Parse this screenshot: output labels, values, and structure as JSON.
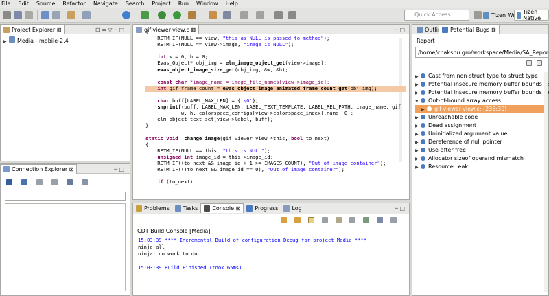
{
  "menu": [
    "File",
    "Edit",
    "Source",
    "Refactor",
    "Navigate",
    "Search",
    "Project",
    "Run",
    "Window",
    "Help"
  ],
  "toolbar": {
    "quick_access_placeholder": "Quick Access",
    "persp_web": "Tizen Web",
    "persp_native": "Tizen Native"
  },
  "left": {
    "project_tab": "Project Explorer",
    "project_item": "Media - mobile-2.4",
    "connection_tab": "Connection Explorer"
  },
  "editor": {
    "tab": "gif-viewer-view.c",
    "lines": [
      {
        "t": "{",
        "c": ""
      },
      {
        "t": "    RETM_IF(NULL == view, \"this as NULL is passed to method\");",
        "c": ""
      },
      {
        "t": "    RETM_IF(NULL == view->image, \"image is NULL\");",
        "c": ""
      },
      {
        "t": "",
        "c": ""
      },
      {
        "t": "    int w = 0, h = 0;",
        "c": ""
      },
      {
        "t": "    Evas_Object* obj_img = elm_image_object_get(view->image);",
        "c": ""
      },
      {
        "t": "    evas_object_image_size_get(obj_img, &w, &h);",
        "c": ""
      },
      {
        "t": "",
        "c": ""
      },
      {
        "t": "    const char *image_name = image_file_names[view->image_id];",
        "c": "hl"
      },
      {
        "t": "    int gif_frame_count = evas_object_image_animated_frame_count_get(obj_img);",
        "c": ""
      },
      {
        "t": "",
        "c": ""
      },
      {
        "t": "    char buff[LABEL_MAX_LEN] = {'\\0'};",
        "c": ""
      },
      {
        "t": "    snprintf(buff, LABEL_MAX_LEN, LABEL_TEXT_TEMPLATE, LABEL_REL_PATH, image_name, gif",
        "c": ""
      },
      {
        "t": "            w, h, colorspace_configs[view->colorspace_index].name, 0);",
        "c": ""
      },
      {
        "t": "    elm_object_text_set(view->label, buff);",
        "c": ""
      },
      {
        "t": "}",
        "c": ""
      },
      {
        "t": "",
        "c": ""
      },
      {
        "t": "static void _change_image(gif_viewer_view *this, bool to_next)",
        "c": ""
      },
      {
        "t": "{",
        "c": ""
      },
      {
        "t": "    RETM_IF(NULL == this, \"this is NULL\");",
        "c": ""
      },
      {
        "t": "    unsigned int image_id = this->image_id;",
        "c": ""
      },
      {
        "t": "    RETM_IF((to_next && image_id + 1 >= IMAGES_COUNT), \"Out of image container\");",
        "c": ""
      },
      {
        "t": "    RETM_IF((!to_next && image_id == 0), \"Out of image container\");",
        "c": ""
      },
      {
        "t": "",
        "c": ""
      },
      {
        "t": "    if (to_next)",
        "c": ""
      }
    ]
  },
  "console": {
    "tabs": [
      "Problems",
      "Tasks",
      "Console",
      "Progress",
      "Log"
    ],
    "title": "CDT Build Console [Media]",
    "lines": [
      {
        "t": "15:03:39 **** Incremental Build of configuration Debug for project Media ****",
        "c": "blue"
      },
      {
        "t": "ninja all",
        "c": ""
      },
      {
        "t": "ninja: no work to do.",
        "c": ""
      },
      {
        "t": "",
        "c": ""
      },
      {
        "t": "15:03:39 Build Finished (took 65ms)",
        "c": "blue"
      }
    ]
  },
  "right": {
    "tabs": [
      "Outline",
      "Potential Bugs"
    ],
    "report_label": "Report",
    "path": "/home/chakshu.gro/workspace/Media/SA_Repor",
    "items": [
      {
        "label": "Cast from non-struct type to struct type",
        "open": false,
        "sel": false,
        "indent": 0
      },
      {
        "label": "Potential insecure memory buffer bounds restrict",
        "open": false,
        "sel": false,
        "indent": 0
      },
      {
        "label": "Potential insecure memory buffer bounds restrict",
        "open": false,
        "sel": false,
        "indent": 0
      },
      {
        "label": "Out-of-bound array access",
        "open": true,
        "sel": false,
        "indent": 0
      },
      {
        "label": "gif-viewer-view.c: (235:30)",
        "open": false,
        "sel": true,
        "indent": 1
      },
      {
        "label": "Unreachable code",
        "open": false,
        "sel": false,
        "indent": 0
      },
      {
        "label": "Dead assignment",
        "open": false,
        "sel": false,
        "indent": 0
      },
      {
        "label": "Uninitialized argument value",
        "open": false,
        "sel": false,
        "indent": 0
      },
      {
        "label": "Dereference of null pointer",
        "open": false,
        "sel": false,
        "indent": 0
      },
      {
        "label": "Use-after-free",
        "open": false,
        "sel": false,
        "indent": 0
      },
      {
        "label": "Allocator sizeof operand mismatch",
        "open": false,
        "sel": false,
        "indent": 0
      },
      {
        "label": "Resource Leak",
        "open": false,
        "sel": false,
        "indent": 0
      }
    ]
  },
  "colors": {
    "selection": "#f0a05a",
    "highlight": "#f4c9a6",
    "console_blue": "#0000ff"
  }
}
